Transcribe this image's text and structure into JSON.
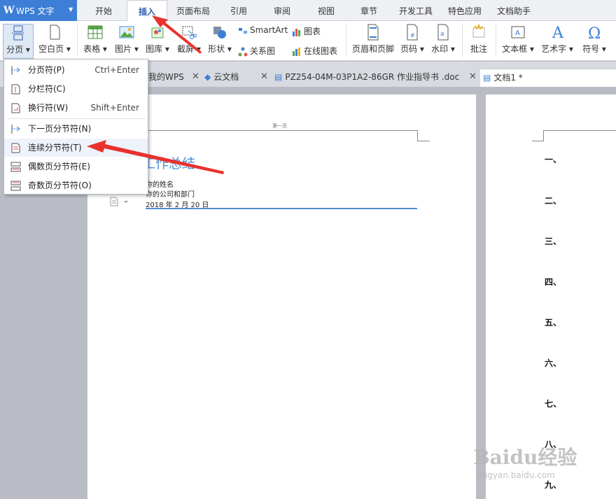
{
  "app": {
    "logo": "W",
    "name": "WPS 文字"
  },
  "ribbon_tabs": [
    "开始",
    "插入",
    "页面布局",
    "引用",
    "审阅",
    "视图",
    "章节",
    "开发工具",
    "特色应用",
    "文档助手"
  ],
  "active_tab": "插入",
  "ribbon": {
    "fenye": "分页",
    "kongbaiye": "空白页",
    "biaoge": "表格",
    "tupian": "图片",
    "tuku": "图库",
    "jieping": "截屏",
    "xingzhuang": "形状",
    "smartart": "SmartArt",
    "tubiao": "图表",
    "guanxitu": "关系图",
    "zaixiantubiao": "在线图表",
    "yemei": "页眉和页脚",
    "yema": "页码",
    "shuiyin": "水印",
    "pizhu": "批注",
    "wenbenkuang": "文本框",
    "yishuzi": "艺术字",
    "fuhao": "符号"
  },
  "doc_tabs": [
    {
      "label": "我的WPS"
    },
    {
      "label": "云文档"
    },
    {
      "label": "PZ254-04M-03P1A2-86GR 作业指导书 .doc"
    },
    {
      "label": "文档1 *"
    }
  ],
  "menu": {
    "items": [
      {
        "label": "分页符(P)",
        "shortcut": "Ctrl+Enter"
      },
      {
        "label": "分栏符(C)",
        "shortcut": ""
      },
      {
        "label": "换行符(W)",
        "shortcut": "Shift+Enter"
      },
      {
        "label": "下一页分节符(N)",
        "shortcut": ""
      },
      {
        "label": "连续分节符(T)",
        "shortcut": ""
      },
      {
        "label": "偶数页分节符(E)",
        "shortcut": ""
      },
      {
        "label": "奇数页分节符(O)",
        "shortcut": ""
      }
    ]
  },
  "page1": {
    "header_text": "第一页",
    "title": "工作总结",
    "lines": [
      "你的姓名",
      "你的公司和部门",
      "2018 年 2 月 20 日"
    ]
  },
  "page2": {
    "outline": [
      "一、",
      "二、",
      "三、",
      "四、",
      "五、",
      "六、",
      "七、",
      "八、",
      "九、"
    ]
  },
  "watermark": {
    "brand": "Baidu经验",
    "url": "jingyan.baidu.com"
  },
  "colors": {
    "accent": "#3d7fd6",
    "annotation": "#e8322f",
    "title_blue": "#4f8fd6"
  }
}
